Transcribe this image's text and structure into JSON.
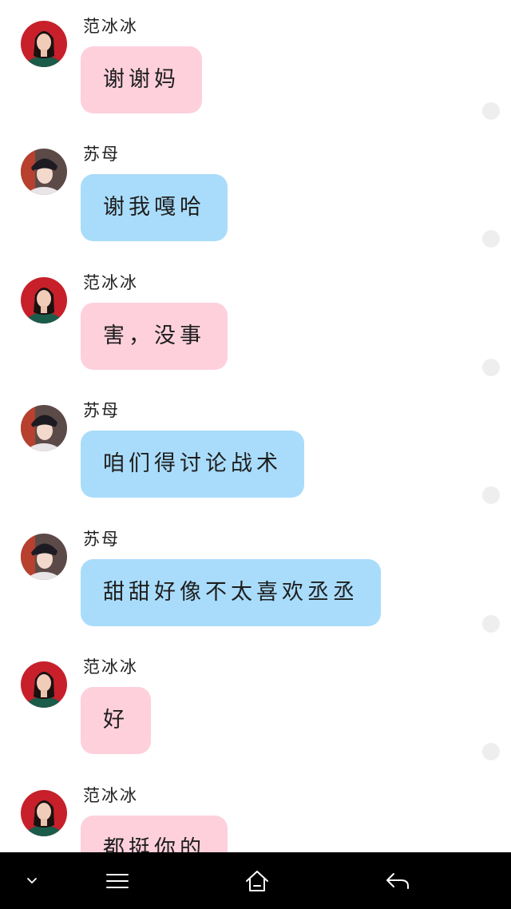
{
  "messages": [
    {
      "sender": "范冰冰",
      "text": "谢谢妈",
      "bubble_color": "#fdd0dc",
      "avatar": "fan-bingbing-avatar"
    },
    {
      "sender": "苏母",
      "text": "谢我嘎哈",
      "bubble_color": "#a9dcfa",
      "avatar": "su-mu-avatar"
    },
    {
      "sender": "范冰冰",
      "text": "害，没事",
      "bubble_color": "#fdd0dc",
      "avatar": "fan-bingbing-avatar"
    },
    {
      "sender": "苏母",
      "text": "咱们得讨论战术",
      "bubble_color": "#a9dcfa",
      "avatar": "su-mu-avatar"
    },
    {
      "sender": "苏母",
      "text": "甜甜好像不太喜欢丞丞",
      "bubble_color": "#a9dcfa",
      "avatar": "su-mu-avatar"
    },
    {
      "sender": "范冰冰",
      "text": "好",
      "bubble_color": "#fdd0dc",
      "avatar": "fan-bingbing-avatar"
    },
    {
      "sender": "范冰冰",
      "text": "都挺你的",
      "bubble_color": "#fdd0dc",
      "avatar": "fan-bingbing-avatar"
    }
  ],
  "navbar": {
    "icons": [
      "chevron-down-icon",
      "menu-icon",
      "home-icon",
      "back-icon"
    ],
    "background": "#000000"
  }
}
